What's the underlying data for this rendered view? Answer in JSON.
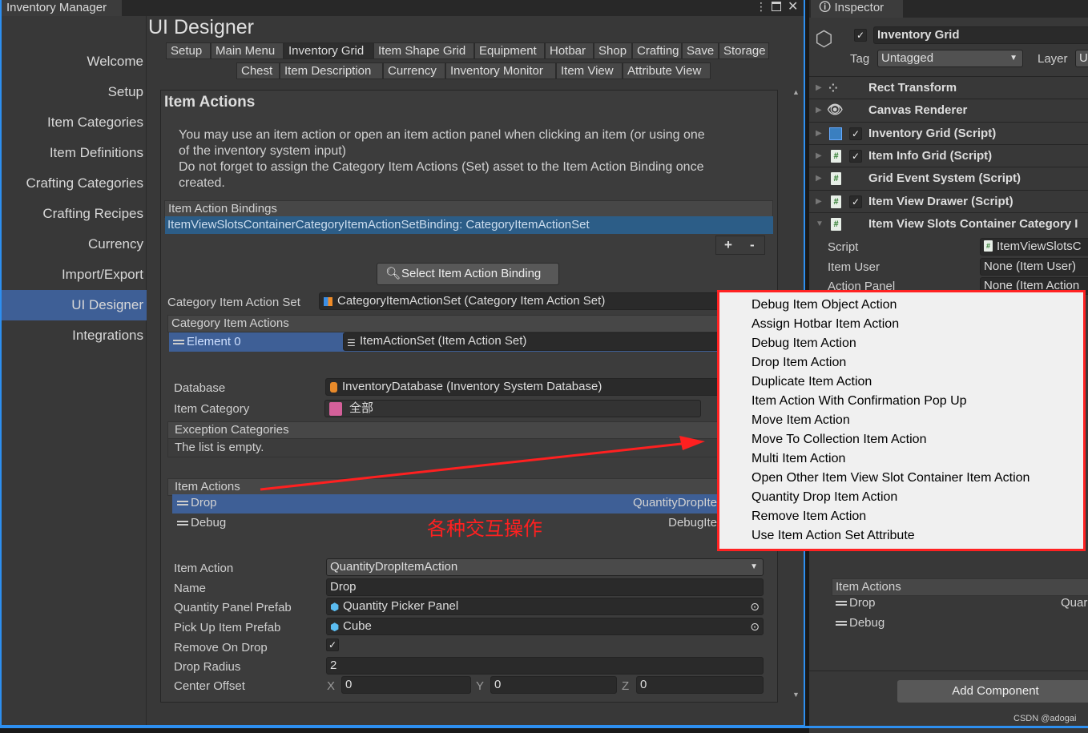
{
  "window": {
    "tab": "Inventory Manager",
    "title": "UI Designer"
  },
  "sidebar": {
    "items": [
      "Welcome",
      "Setup",
      "Item Categories",
      "Item Definitions",
      "Crafting Categories",
      "Crafting Recipes",
      "Currency",
      "Import/Export",
      "UI Designer",
      "Integrations"
    ],
    "selected": "UI Designer"
  },
  "tabs": {
    "row1": [
      "Setup",
      "Main Menu",
      "Inventory Grid",
      "Item Shape Grid",
      "Equipment",
      "Hotbar",
      "Shop",
      "Crafting",
      "Save",
      "Storage"
    ],
    "row2": [
      "Chest",
      "Item Description",
      "Currency",
      "Inventory Monitor",
      "Item View",
      "Attribute View"
    ],
    "active": "Inventory Grid"
  },
  "panel": {
    "title": "Item Actions",
    "desc1": "You may use an item action or open an item action panel when clicking an item (or using one",
    "desc2": "of the inventory system input)",
    "desc3": "Do not forget to assign the Category Item Actions (Set) asset to the Item Action Binding once",
    "desc4": "created.",
    "bindings_header": "Item Action Bindings",
    "binding_item": "ItemViewSlotsContainerCategoryItemActionSetBinding: CategoryItemActionSet",
    "plus": "+",
    "minus": "-",
    "select_button": "Select Item Action Binding",
    "cias_label": "Category Item Action Set",
    "cias_value": "CategoryItemActionSet (Category Item Action Set)",
    "cia_header": "Category Item Actions",
    "element0": "Element 0",
    "element0_value": "ItemActionSet (Item Action Set)",
    "database_label": "Database",
    "database_value": "InventoryDatabase (Inventory System Database)",
    "category_label": "Item Category",
    "category_value": "全部",
    "category_color": "#d4609a",
    "exception_header": "Exception Categories",
    "empty": "The list is empty.",
    "actions_header": "Item Actions",
    "actions": [
      {
        "name": "Drop",
        "type": "QuantityDropIte"
      },
      {
        "name": "Debug",
        "type": "DebugIte"
      }
    ],
    "fields": {
      "item_action_label": "Item Action",
      "item_action": "QuantityDropItemAction",
      "name_label": "Name",
      "name": "Drop",
      "qpp_label": "Quantity Panel Prefab",
      "qpp": "Quantity Picker Panel",
      "puip_label": "Pick Up Item Prefab",
      "puip": "Cube",
      "rod_label": "Remove On Drop",
      "remove_on_drop": true,
      "dr_label": "Drop Radius",
      "drop_radius": "2",
      "co_label": "Center Offset",
      "x_label": "X",
      "x": "0",
      "y_label": "Y",
      "y": "0",
      "z_label": "Z",
      "z": "0"
    }
  },
  "annotation": {
    "text": "各种交互操作",
    "color": "#ff2020"
  },
  "inspector": {
    "tab": "Inspector",
    "object_name": "Inventory Grid",
    "tag_label": "Tag",
    "tag": "Untagged",
    "layer_label": "Layer",
    "layer": "U",
    "components": [
      "Rect Transform",
      "Canvas Renderer",
      "Inventory Grid (Script)",
      "Item Info Grid (Script)",
      "Grid Event System (Script)",
      "Item View Drawer (Script)",
      "Item View Slots Container Category I"
    ],
    "script_label": "Script",
    "script": "ItemViewSlotsC",
    "item_user_label": "Item User",
    "item_user": "None (Item User)",
    "action_panel_label": "Action Panel",
    "action_panel": "None (Item Action",
    "actions_header": "Item Actions",
    "actions": [
      "Drop",
      "Debug"
    ],
    "action_type": "Quar",
    "add_component": "Add Component",
    "watermark": "CSDN @adogai"
  },
  "menu": {
    "items": [
      "Debug Item Object Action",
      "Assign Hotbar Item Action",
      "Debug Item Action",
      "Drop Item Action",
      "Duplicate Item Action",
      "Item Action With Confirmation Pop Up",
      "Move Item Action",
      "Move To Collection Item Action",
      "Multi Item Action",
      "Open Other Item View Slot Container Item Action",
      "Quantity Drop Item Action",
      "Remove Item Action",
      "Use Item Action Set Attribute"
    ]
  }
}
